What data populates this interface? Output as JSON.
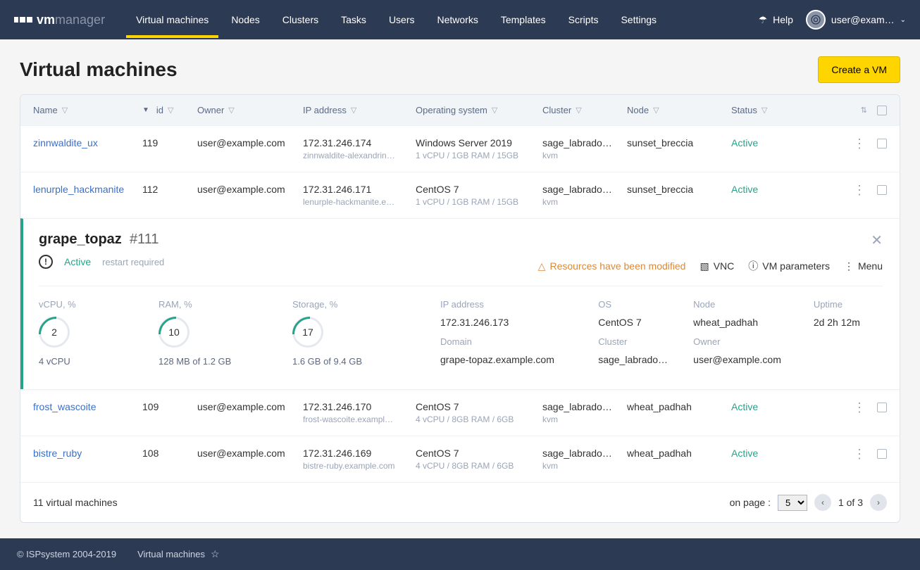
{
  "logo": {
    "bold": "vm",
    "light": "manager"
  },
  "nav": [
    {
      "label": "Virtual machines",
      "active": true
    },
    {
      "label": "Nodes"
    },
    {
      "label": "Clusters"
    },
    {
      "label": "Tasks"
    },
    {
      "label": "Users"
    },
    {
      "label": "Networks"
    },
    {
      "label": "Templates"
    },
    {
      "label": "Scripts"
    },
    {
      "label": "Settings"
    }
  ],
  "header": {
    "help": "Help",
    "user": "user@exam…"
  },
  "page": {
    "title": "Virtual machines",
    "create_btn": "Create a VM"
  },
  "columns": {
    "name": "Name",
    "id": "id",
    "owner": "Owner",
    "ip": "IP address",
    "os": "Operating system",
    "cluster": "Cluster",
    "node": "Node",
    "status": "Status"
  },
  "rows": [
    {
      "name": "zinnwaldite_ux",
      "id": "119",
      "owner": "user@example.com",
      "ip": "172.31.246.174",
      "domain": "zinnwaldite-alexandrin…",
      "os": "Windows Server 2019",
      "specs": "1 vCPU / 1GB RAM / 15GB",
      "cluster": "sage_labrado…",
      "cluster_sub": "kvm",
      "node": "sunset_breccia",
      "status": "Active"
    },
    {
      "name": "lenurple_hackmanite",
      "id": "112",
      "owner": "user@example.com",
      "ip": "172.31.246.171",
      "domain": "lenurple-hackmanite.e…",
      "os": "CentOS 7",
      "specs": "1 vCPU / 1GB RAM / 15GB",
      "cluster": "sage_labrado…",
      "cluster_sub": "kvm",
      "node": "sunset_breccia",
      "status": "Active"
    },
    {
      "name": "frost_wascoite",
      "id": "109",
      "owner": "user@example.com",
      "ip": "172.31.246.170",
      "domain": "frost-wascoite.exampl…",
      "os": "CentOS 7",
      "specs": "4 vCPU / 8GB RAM / 6GB",
      "cluster": "sage_labrado…",
      "cluster_sub": "kvm",
      "node": "wheat_padhah",
      "status": "Active"
    },
    {
      "name": "bistre_ruby",
      "id": "108",
      "owner": "user@example.com",
      "ip": "172.31.246.169",
      "domain": "bistre-ruby.example.com",
      "os": "CentOS 7",
      "specs": "4 vCPU / 8GB RAM / 6GB",
      "cluster": "sage_labrado…",
      "cluster_sub": "kvm",
      "node": "wheat_padhah",
      "status": "Active"
    }
  ],
  "detail": {
    "name": "grape_topaz",
    "hash": "#111",
    "status": "Active",
    "restart": "restart required",
    "warn_msg": "Resources have been modified",
    "vnc": "VNC",
    "params": "VM parameters",
    "menu": "Menu",
    "metrics": {
      "vcpu_label": "vCPU, %",
      "vcpu_val": "2",
      "vcpu_sub": "4 vCPU",
      "ram_label": "RAM, %",
      "ram_val": "10",
      "ram_sub": "128 MB of 1.2 GB",
      "storage_label": "Storage, %",
      "storage_val": "17",
      "storage_sub": "1.6 GB of 9.4 GB"
    },
    "info": {
      "ip_label": "IP address",
      "ip": "172.31.246.173",
      "domain_label": "Domain",
      "domain": "grape-topaz.example.com",
      "os_label": "OS",
      "os": "CentOS 7",
      "cluster_label": "Cluster",
      "cluster": "sage_labrado…",
      "node_label": "Node",
      "node": "wheat_padhah",
      "owner_label": "Owner",
      "owner": "user@example.com",
      "uptime_label": "Uptime",
      "uptime": "2d 2h 12m"
    }
  },
  "footer_table": {
    "count": "11 virtual machines",
    "on_page": "on page :",
    "page_size": "5",
    "page_of": "1 of 3"
  },
  "footer": {
    "copyright": "© ISPsystem 2004-2019",
    "breadcrumb": "Virtual machines"
  }
}
